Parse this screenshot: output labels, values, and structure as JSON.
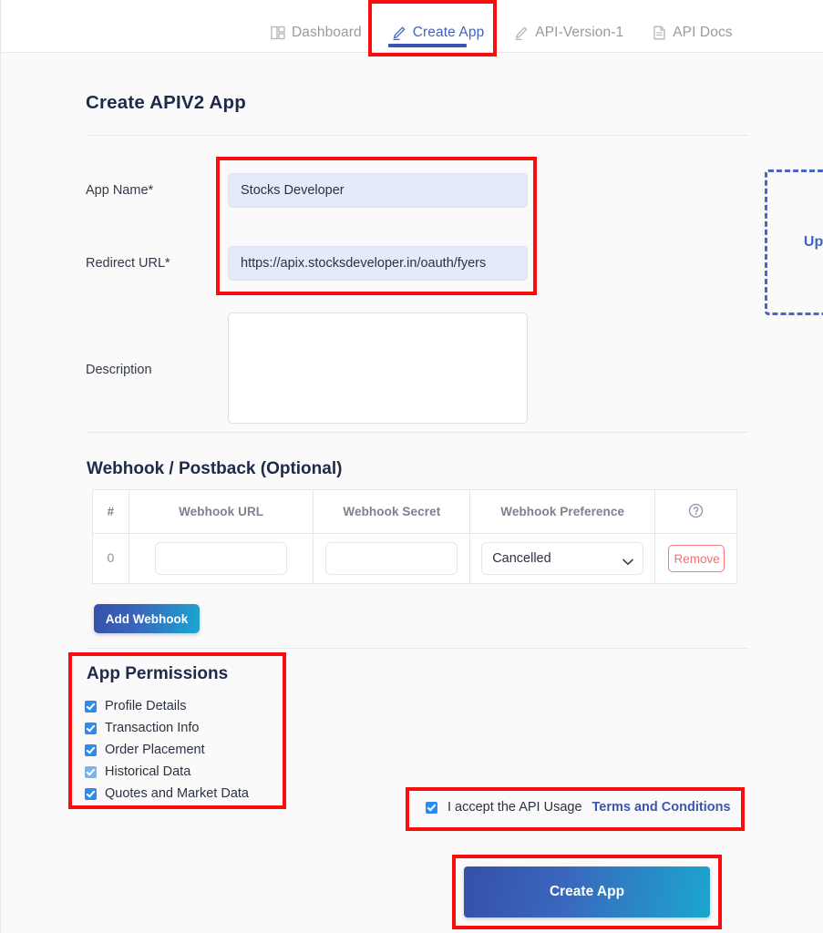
{
  "nav": {
    "tabs": [
      {
        "label": "Dashboard",
        "icon": "dashboard-grid-icon",
        "active": false
      },
      {
        "label": "Create App",
        "icon": "pencil-icon",
        "active": true
      },
      {
        "label": "API-Version-1",
        "icon": "pencil-icon",
        "active": false
      },
      {
        "label": "API Docs",
        "icon": "document-icon",
        "active": false
      }
    ]
  },
  "page": {
    "title": "Create APIV2 App"
  },
  "form": {
    "app_name": {
      "label": "App Name*",
      "value": "Stocks Developer",
      "placeholder": ""
    },
    "redirect_url": {
      "label": "Redirect URL*",
      "value": "https://apix.stocksdeveloper.in/oauth/fyers",
      "placeholder": ""
    },
    "description": {
      "label": "Description",
      "value": "",
      "placeholder": ""
    }
  },
  "upload": {
    "label": "Upload"
  },
  "webhook": {
    "heading": "Webhook / Postback (Optional)",
    "columns": [
      "#",
      "Webhook URL",
      "Webhook Secret",
      "Webhook Preference",
      "help-icon"
    ],
    "rows": [
      {
        "index": "0",
        "url": "",
        "url_placeholder": "",
        "secret": "",
        "secret_placeholder": "",
        "preference": "Cancelled",
        "preference_options": [
          "Cancelled"
        ],
        "remove_label": "Remove"
      }
    ],
    "add_label": "Add Webhook"
  },
  "permissions": {
    "heading": "App Permissions",
    "items": [
      {
        "label": "Profile Details",
        "checked": true,
        "pale": false
      },
      {
        "label": "Transaction Info",
        "checked": true,
        "pale": false
      },
      {
        "label": "Order Placement",
        "checked": true,
        "pale": false
      },
      {
        "label": "Historical Data",
        "checked": true,
        "pale": true
      },
      {
        "label": "Quotes and Market Data",
        "checked": true,
        "pale": false
      }
    ]
  },
  "terms": {
    "checked": true,
    "text": "I accept the API Usage",
    "link_label": "Terms and Conditions"
  },
  "submit": {
    "label": "Create App"
  },
  "colors": {
    "accent_blue": "#4263c4",
    "underline_blue": "#3b56b0",
    "checkbox_blue": "#2b8cf0",
    "remove_red": "#fb6c6c",
    "input_fill": "#e4eaf7",
    "annotation_red": "#fb0d0d",
    "gradient_start": "#3550a8",
    "gradient_end": "#1ba6cf"
  }
}
